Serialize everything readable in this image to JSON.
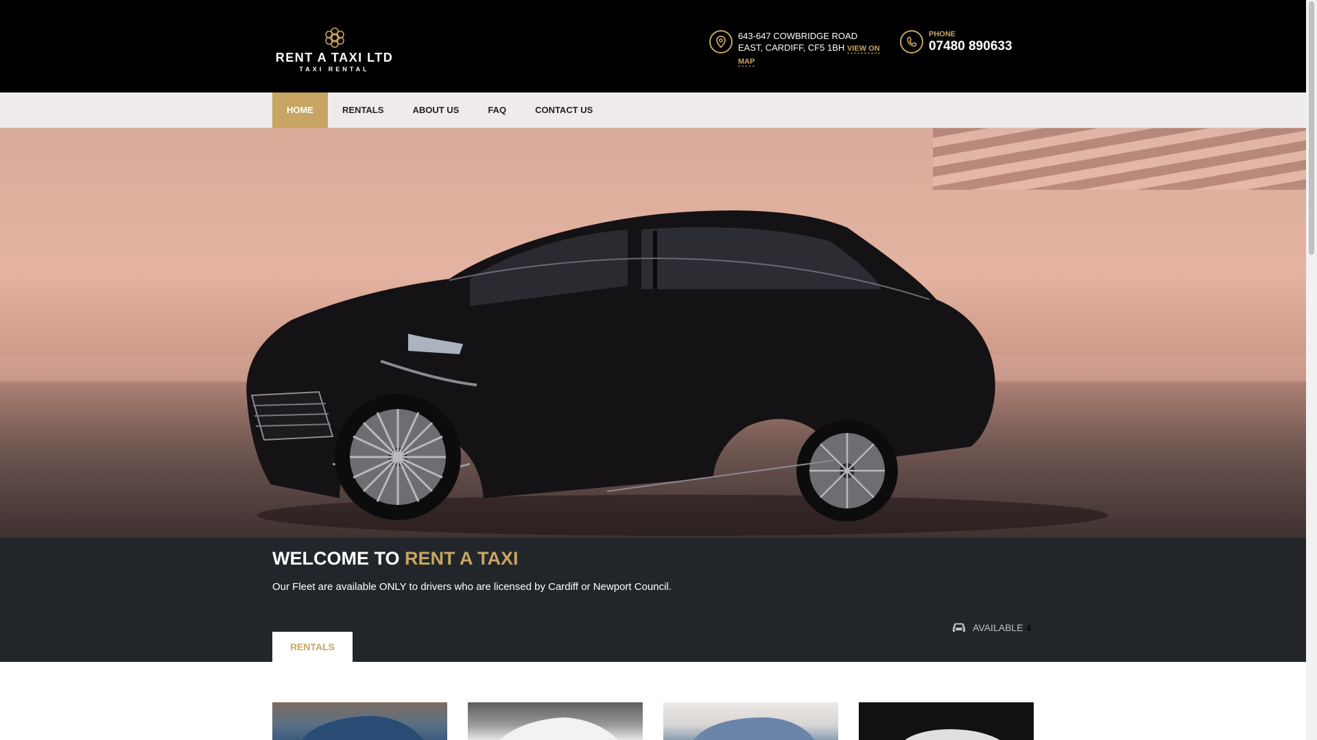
{
  "header": {
    "logo_name": "RENT A TAXI LTD",
    "logo_sub": "TAXI RENTAL",
    "address_line1": "643-647 COWBRIDGE ROAD",
    "address_line2": "EAST, CARDIFF, CF5 1BH",
    "map_link": "VIEW ON MAP",
    "phone_label": "PHONE",
    "phone_number": "07480 890633"
  },
  "nav": {
    "items": [
      {
        "label": "HOME",
        "active": true
      },
      {
        "label": "RENTALS",
        "active": false
      },
      {
        "label": "ABOUT US",
        "active": false
      },
      {
        "label": "FAQ",
        "active": false
      },
      {
        "label": "CONTACT US",
        "active": false
      }
    ]
  },
  "welcome": {
    "title_prefix": "WELCOME TO",
    "title_accent": "RENT A TAXI",
    "text": "Our Fleet are available ONLY to drivers who are licensed by Cardiff or Newport Council.",
    "tab_label": "RENTALS",
    "available_label": "AVAILABLE",
    "available_count": "4"
  },
  "colors": {
    "accent": "#c8a562",
    "header_bg": "#000000",
    "band_bg": "#22262a"
  },
  "icons": {
    "address": "map-pin-icon",
    "phone": "phone-icon",
    "available": "car-icon"
  }
}
